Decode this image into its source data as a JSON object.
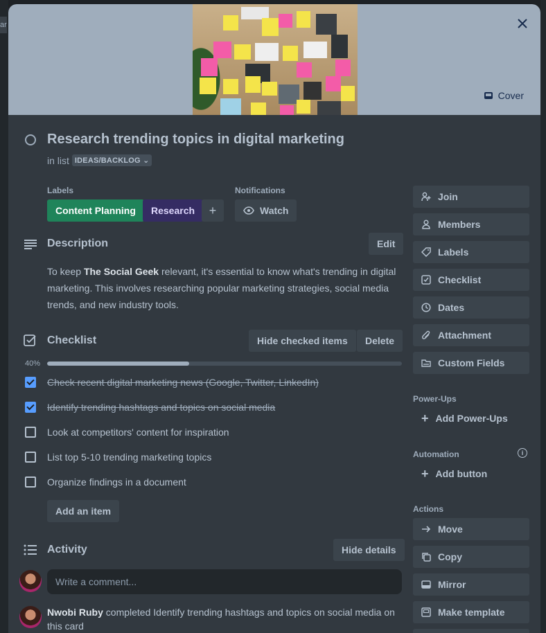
{
  "background": {
    "tab_fragment": "ar"
  },
  "cover": {
    "button_label": "Cover"
  },
  "card": {
    "title": "Research trending topics  in digital marketing",
    "in_list_prefix": "in list",
    "list_name": "IDEAS/BACKLOG"
  },
  "labels": {
    "heading": "Labels",
    "items": [
      {
        "text": "Content Planning",
        "color": "#1f845a"
      },
      {
        "text": "Research",
        "color": "#352c63"
      }
    ],
    "add": "+"
  },
  "notifications": {
    "heading": "Notifications",
    "watch_label": "Watch"
  },
  "description": {
    "title": "Description",
    "edit_label": "Edit",
    "text_before": "To keep ",
    "text_bold": "The Social Geek",
    "text_after": " relevant, it's essential to know what's trending in digital marketing. This involves researching popular marketing strategies, social media trends, and new industry tools."
  },
  "checklist": {
    "title": "Checklist",
    "hide_checked_label": "Hide checked items",
    "delete_label": "Delete",
    "progress_text": "40%",
    "progress": 0.4,
    "items": [
      {
        "text": "Check recent digital marketing news (Google, Twitter, LinkedIn)",
        "checked": true
      },
      {
        "text": "Identify trending hashtags and topics on social media",
        "checked": true
      },
      {
        "text": "Look at competitors' content for inspiration",
        "checked": false
      },
      {
        "text": "List top 5-10 trending marketing topics",
        "checked": false
      },
      {
        "text": "Organize findings in a document",
        "checked": false
      }
    ],
    "add_item_label": "Add an item"
  },
  "activity": {
    "title": "Activity",
    "hide_details_label": "Hide details",
    "comment_placeholder": "Write a comment...",
    "entry_user": "Nwobi Ruby",
    "entry_text": " completed Identify trending hashtags and topics on social media on this card"
  },
  "sidebar": {
    "add_to_card": [
      {
        "label": "Join",
        "icon": "person-add-icon"
      },
      {
        "label": "Members",
        "icon": "person-icon"
      },
      {
        "label": "Labels",
        "icon": "tag-icon"
      },
      {
        "label": "Checklist",
        "icon": "checklist-icon"
      },
      {
        "label": "Dates",
        "icon": "clock-icon"
      },
      {
        "label": "Attachment",
        "icon": "paperclip-icon"
      },
      {
        "label": "Custom Fields",
        "icon": "fields-icon"
      }
    ],
    "powerups_heading": "Power-Ups",
    "add_powerups_label": "Add Power-Ups",
    "automation_heading": "Automation",
    "add_button_label": "Add button",
    "actions_heading": "Actions",
    "actions": [
      {
        "label": "Move",
        "icon": "arrow-right-icon"
      },
      {
        "label": "Copy",
        "icon": "copy-icon"
      },
      {
        "label": "Mirror",
        "icon": "mirror-icon"
      },
      {
        "label": "Make template",
        "icon": "template-icon"
      }
    ]
  }
}
